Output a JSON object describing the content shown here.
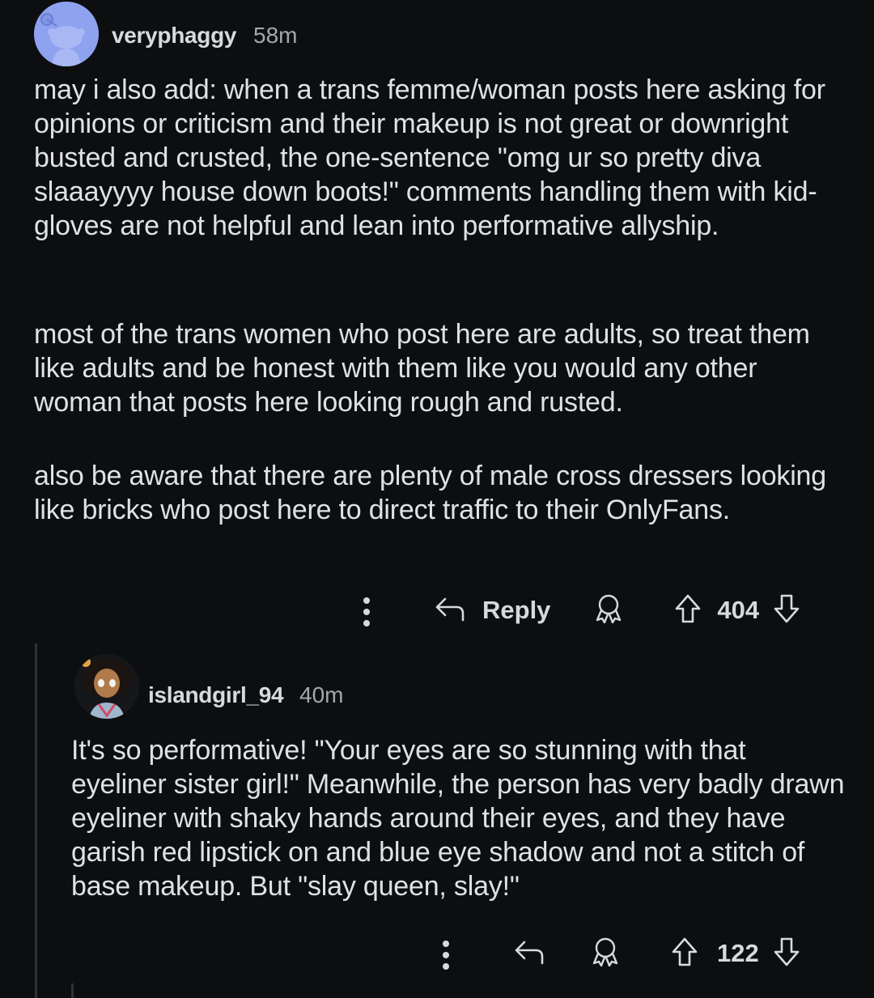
{
  "comments": [
    {
      "username": "veryphaggy",
      "time": "58m",
      "paragraphs": [
        "may i also add: when a trans femme/woman posts here asking for opinions or criticism and their makeup is not great or downright busted and crusted, the one-sentence \"omg ur so pretty diva slaaayyyy house down boots!\" comments handling them with kid-gloves are not helpful and lean into performative allyship.",
        "most of the trans women who post here are adults, so treat them like adults and be honest with them like you would any other woman that posts here looking rough and rusted.",
        "also be aware that there are plenty of male cross dressers looking like bricks who post here to direct traffic to their OnlyFans."
      ],
      "reply_label": "Reply",
      "score": "404"
    },
    {
      "username": "islandgirl_94",
      "time": "40m",
      "paragraphs": [
        "It's so performative! \"Your eyes are so stunning with that eyeliner sister girl!\" Meanwhile, the person has very badly drawn eyeliner with shaky hands around their eyes, and they have garish red lipstick on and blue eye shadow and not a stitch of base makeup. But \"slay queen, slay!\""
      ],
      "score": "122"
    }
  ],
  "icons": [
    "more-icon",
    "reply-arrow-icon",
    "award-icon",
    "upvote-icon",
    "downvote-icon"
  ],
  "colors": {
    "background": "#0d0e10",
    "text": "#d7dadc",
    "muted": "#a4a8ab",
    "avatar": "#8ea2f0"
  }
}
